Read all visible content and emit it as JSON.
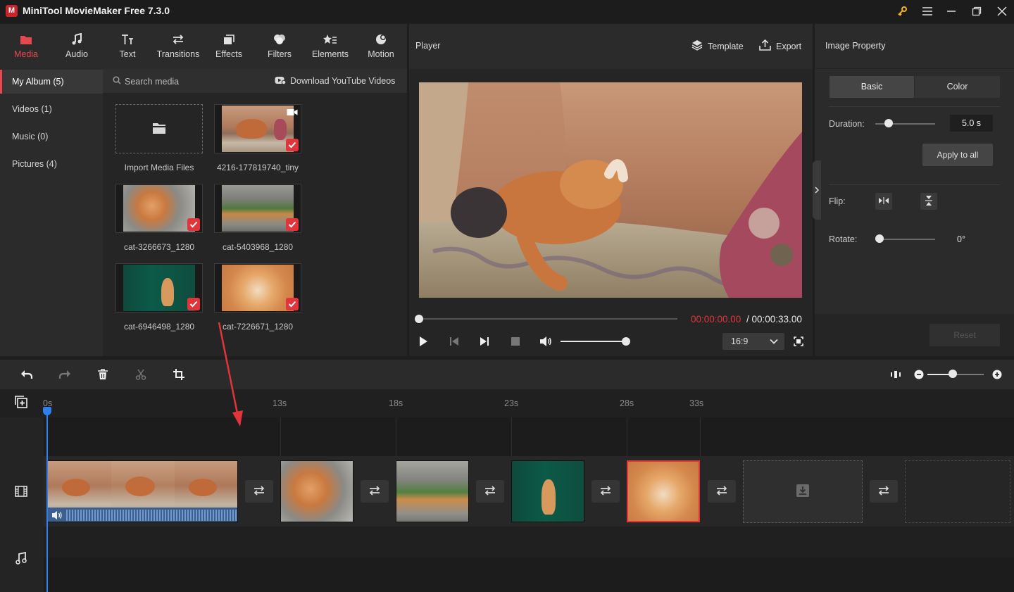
{
  "app": {
    "title": "MiniTool MovieMaker Free 7.3.0",
    "logo_letter": "M"
  },
  "window_controls": [
    "key-icon",
    "menu-icon",
    "minimize-icon",
    "maximize-icon",
    "close-icon"
  ],
  "media_tabs": [
    {
      "label": "Media",
      "icon": "media-icon",
      "active": true
    },
    {
      "label": "Audio",
      "icon": "audio-icon"
    },
    {
      "label": "Text",
      "icon": "text-icon"
    },
    {
      "label": "Transitions",
      "icon": "transitions-icon"
    },
    {
      "label": "Effects",
      "icon": "effects-icon"
    },
    {
      "label": "Filters",
      "icon": "filters-icon"
    },
    {
      "label": "Elements",
      "icon": "elements-icon"
    },
    {
      "label": "Motion",
      "icon": "motion-icon"
    }
  ],
  "album": {
    "items": [
      {
        "label": "My Album (5)",
        "active": true
      },
      {
        "label": "Videos (1)"
      },
      {
        "label": "Music (0)"
      },
      {
        "label": "Pictures (4)"
      }
    ]
  },
  "media_toolbar": {
    "search_placeholder": "Search media",
    "youtube_label": "Download YouTube Videos"
  },
  "media_items": [
    {
      "label": "Import Media Files",
      "type": "import"
    },
    {
      "label": "4216-177819740_tiny",
      "type": "video",
      "checked": true
    },
    {
      "label": "cat-3266673_1280",
      "type": "image",
      "checked": true
    },
    {
      "label": "cat-5403968_1280",
      "type": "image",
      "checked": true
    },
    {
      "label": "cat-6946498_1280",
      "type": "image",
      "checked": true
    },
    {
      "label": "cat-7226671_1280",
      "type": "image",
      "checked": true
    }
  ],
  "player": {
    "title": "Player",
    "template_label": "Template",
    "export_label": "Export",
    "time_current": "00:00:00.00",
    "time_separator": " / ",
    "time_total": "00:00:33.00",
    "progress": 0,
    "volume": 1.0,
    "aspect_ratio": "16:9"
  },
  "property": {
    "title": "Image Property",
    "tabs": [
      "Basic",
      "Color"
    ],
    "active_tab": "Basic",
    "duration_label": "Duration:",
    "duration_value": "5.0 s",
    "apply_all_label": "Apply to all",
    "flip_label": "Flip:",
    "rotate_label": "Rotate:",
    "rotate_value": "0°",
    "reset_label": "Reset"
  },
  "timeline": {
    "ruler_ticks": [
      "0s",
      "13s",
      "18s",
      "23s",
      "28s",
      "33s"
    ],
    "zoom_level": 0.45,
    "clips": [
      {
        "name": "4216-177819740_tiny",
        "type": "video"
      },
      {
        "name": "cat-3266673_1280",
        "type": "image"
      },
      {
        "name": "cat-5403968_1280",
        "type": "image"
      },
      {
        "name": "cat-6946498_1280",
        "type": "image"
      },
      {
        "name": "cat-7226671_1280",
        "type": "image",
        "selected": true
      }
    ]
  },
  "colors": {
    "accent": "#e2343b",
    "playhead": "#2f80ed",
    "panel": "#2b2b2b"
  }
}
